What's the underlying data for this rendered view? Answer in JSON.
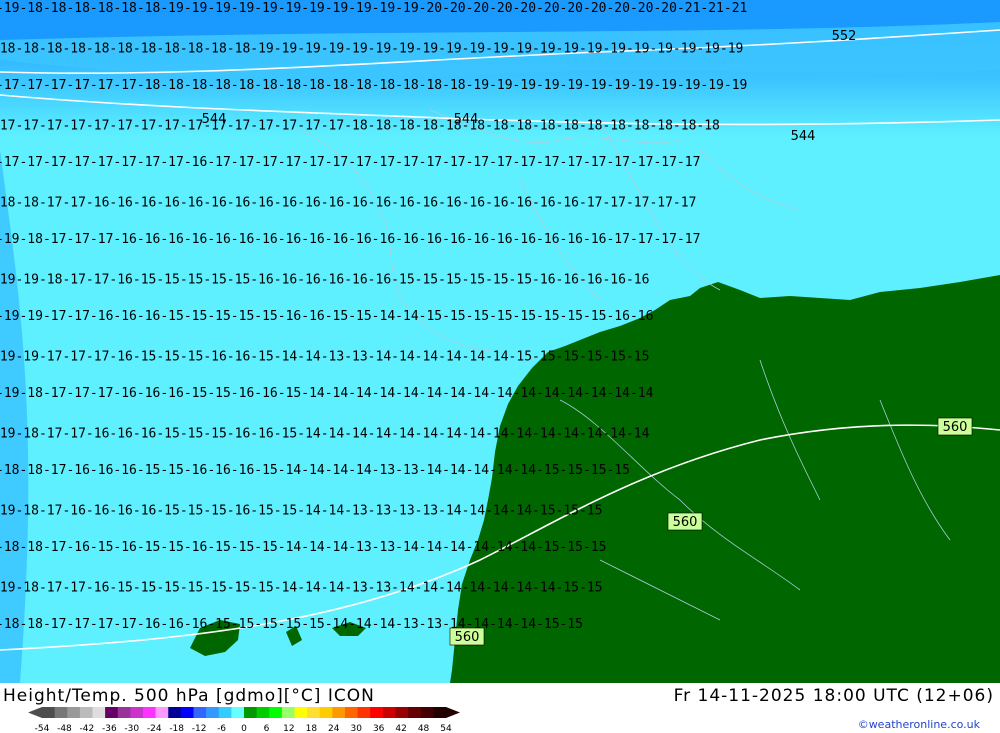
{
  "title": "Height/Temp. 500 hPa [gdmo][°C] ICON",
  "run_time": "Fr 14-11-2025 18:00 UTC (12+06)",
  "credit": "©weatheronline.co.uk",
  "colors": {
    "water_deep": "#1a99ff",
    "water_mid": "#3cc6ff",
    "water_light": "#5ef0ff",
    "land": "#006600",
    "isohypse": "#ffffff",
    "isotherm_stroke": "#000000",
    "border": "#aaccdd",
    "label_box": "#ccff99"
  },
  "geopotential_labels": [
    "544",
    "544",
    "544",
    "552",
    "560",
    "560",
    "560"
  ],
  "isotherm_labels": {
    "row_1": "-19-18-18-18-18-18-18-19-19-19-19-19-19-19-19-19-19-19-20-20-20-20-20-20-20-20-20-20-20-21-21-21",
    "row_2": "-18-18-18-18-18-18-18-18-18-18-18-19-19-19-19-19-19-19-19-19-19-19-19-19-19-19-19-19-19-19-19-19",
    "row_3": "-17-17-17-17-17-17-18-18-18-18-18-18-18-18-18-18-18-18-18-18-19-19-19-19-19-19-19-19-19-19-19-19",
    "row_4": "-17-17-17-17-17-17-17-17-17-17-17-17-17-17-17-18-18-18-18-18-18-18-18-18-18-18-18-18-18-18-18",
    "row_5": "-17-17-17-17-17-17-17-17-16-17-17-17-17-17-17-17-17-17-17-17-17-17-17-17-17-17-17-17-17-17",
    "row_6": "-18-18-17-17-16-16-16-16-16-16-16-16-16-16-16-16-16-16-16-16-16-16-16-16-16-17-17-17-17-17",
    "row_7": "-19-18-17-17-17-16-16-16-16-16-16-16-16-16-16-16-16-16-16-16-16-16-16-16-16-16-17-17-17-17",
    "row_8": "-19-19-18-17-17-16-15-15-15-15-15-16-16-16-16-16-16-15-15-15-15-15-15-16-16-16-16-16",
    "row_9": "-19-19-17-17-16-16-16-15-15-15-15-15-16-16-15-15-14-14-15-15-15-15-15-15-15-15-16-16",
    "row_10": "-19-19-17-17-17-16-15-15-15-16-16-15-14-14-13-13-14-14-14-14-14-14-15-15-15-15-15-15",
    "row_11": "-19-18-17-17-17-16-16-16-15-15-16-16-15-14-14-14-14-14-14-14-14-14-14-14-14-14-14-14",
    "row_12": "-19-18-17-17-16-16-16-15-15-15-16-16-15-14-14-14-14-14-14-14-14-14-14-14-14-14-14-14",
    "row_13": "-18-18-17-16-16-16-15-15-16-16-16-15-14-14-14-14-13-13-14-14-14-14-14-15-15-15-15",
    "row_14": "-19-18-17-16-16-16-16-15-15-15-16-15-15-14-14-13-13-13-13-14-14-14-14-15-15-15",
    "row_15": "-18-18-17-16-15-16-15-15-16-15-15-15-14-14-14-13-13-14-14-14-14-14-14-15-15-15",
    "row_16": "-19-18-17-17-16-15-15-15-15-15-15-15-14-14-14-13-13-14-14-14-14-14-14-14-15-15",
    "row_17": "-18-18-17-17-17-17-16-16-16-15-15-15-15-15-14-14-14-13-13-14-14-14-14-15-15"
  },
  "legend": {
    "ticks": [
      "-54",
      "-48",
      "-42",
      "-36",
      "-30",
      "-24",
      "-18",
      "-12",
      "-6",
      "0",
      "6",
      "12",
      "18",
      "24",
      "30",
      "36",
      "42",
      "48",
      "54"
    ],
    "colors": [
      "#4d4d4d",
      "#777777",
      "#999999",
      "#bbbbbb",
      "#dddddd",
      "#660066",
      "#993399",
      "#cc33cc",
      "#ff33ff",
      "#ff99ff",
      "#000099",
      "#0000ff",
      "#3366ff",
      "#3399ff",
      "#33ccff",
      "#66ffff",
      "#009900",
      "#00cc00",
      "#00ff00",
      "#99ff66",
      "#ffff00",
      "#ffdd33",
      "#ffcc00",
      "#ff9900",
      "#ff6600",
      "#ff3300",
      "#ff0000",
      "#cc0000",
      "#990000",
      "#660000",
      "#440000",
      "#220000"
    ]
  }
}
